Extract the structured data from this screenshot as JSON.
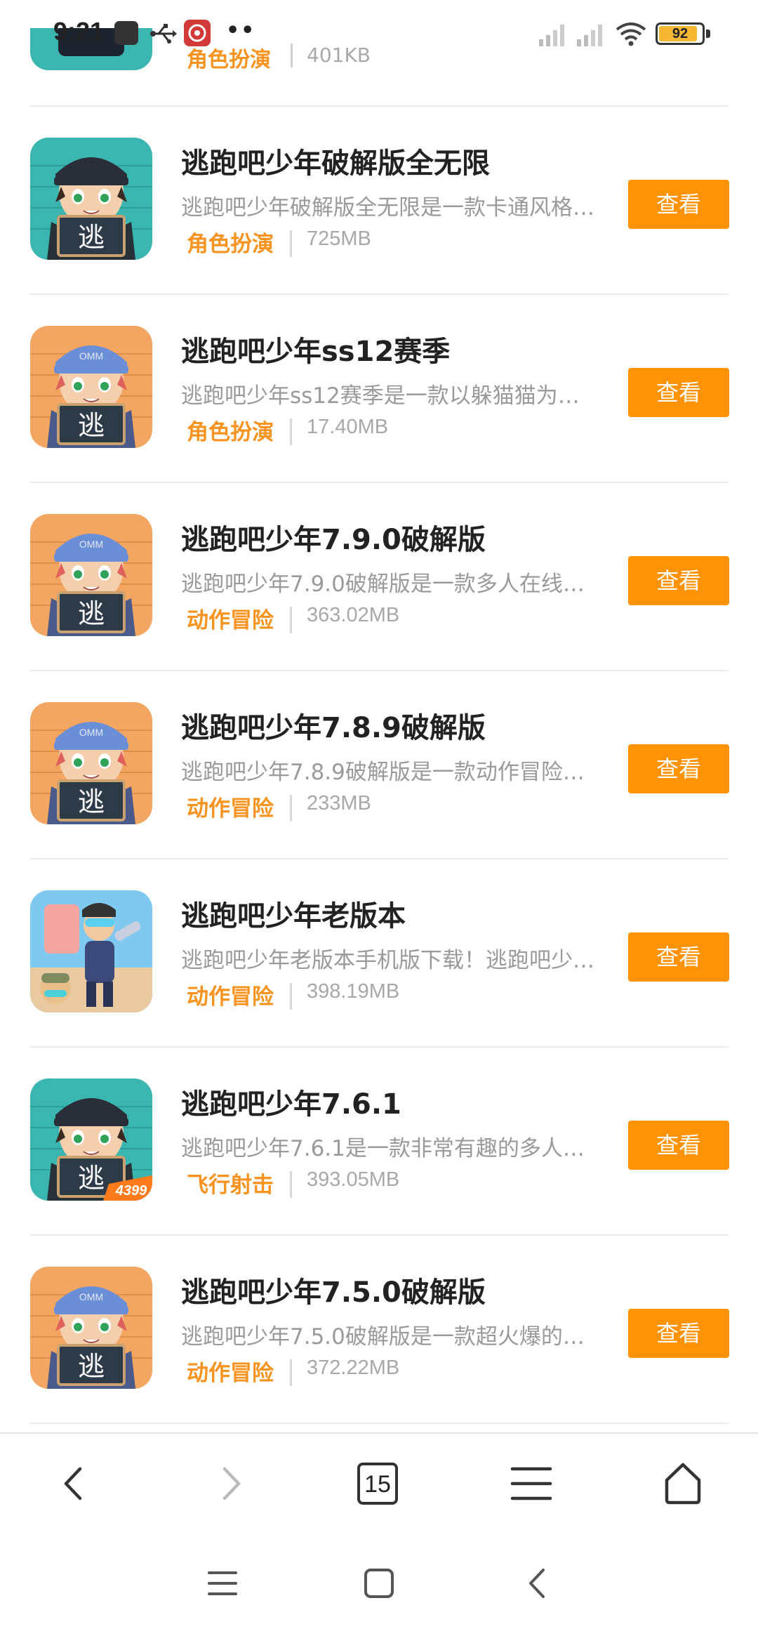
{
  "status_bar": {
    "time": "9:21",
    "battery": "92",
    "icons": [
      "app-square-icon",
      "usb-icon",
      "app-icon",
      "more-dots-icon",
      "signal-icon",
      "signal-icon",
      "wifi-icon",
      "battery-icon"
    ]
  },
  "partial_item": {
    "category": "角色扮演",
    "size": "401KB"
  },
  "items": [
    {
      "title": "逃跑吧少年破解版全无限",
      "desc": "逃跑吧少年破解版全无限是一款卡通风格的多人竞技手游",
      "category": "角色扮演",
      "size": "725MB",
      "button": "查看",
      "icon": "dark-cap"
    },
    {
      "title": "逃跑吧少年ss12赛季",
      "desc": "逃跑吧少年ss12赛季是一款以躲猫猫为主题的游戏",
      "category": "角色扮演",
      "size": "17.40MB",
      "button": "查看",
      "icon": "blue-cap"
    },
    {
      "title": "逃跑吧少年7.9.0破解版",
      "desc": "逃跑吧少年7.9.0破解版是一款多人在线竞技游戏",
      "category": "动作冒险",
      "size": "363.02MB",
      "button": "查看",
      "icon": "blue-cap"
    },
    {
      "title": "逃跑吧少年7.8.9破解版",
      "desc": "逃跑吧少年7.8.9破解版是一款动作冒险类手游",
      "category": "动作冒险",
      "size": "233MB",
      "button": "查看",
      "icon": "blue-cap"
    },
    {
      "title": "逃跑吧少年老版本",
      "desc": "逃跑吧少年老版本手机版下载！逃跑吧少年是一款",
      "category": "动作冒险",
      "size": "398.19MB",
      "button": "查看",
      "icon": "soldier"
    },
    {
      "title": "逃跑吧少年7.6.1",
      "desc": "逃跑吧少年7.6.1是一款非常有趣的多人竞技游戏",
      "category": "飞行射击",
      "size": "393.05MB",
      "button": "查看",
      "icon": "dark-cap-4399",
      "badge": "4399"
    },
    {
      "title": "逃跑吧少年7.5.0破解版",
      "desc": "逃跑吧少年7.5.0破解版是一款超火爆的竞技游戏",
      "category": "动作冒险",
      "size": "372.22MB",
      "button": "查看",
      "icon": "blue-cap"
    }
  ],
  "icon_text": {
    "sign": "逃",
    "cap": "OMM"
  },
  "toolbar": {
    "tab_count": "15",
    "icons": [
      "back-icon",
      "forward-icon",
      "tabs-icon",
      "menu-icon",
      "home-icon"
    ]
  },
  "system_nav": {
    "icons": [
      "recents-icon",
      "home-icon",
      "back-icon"
    ]
  },
  "colors": {
    "accent": "#ff9305",
    "category": "#f7931e",
    "desc": "#9a9a9a"
  }
}
